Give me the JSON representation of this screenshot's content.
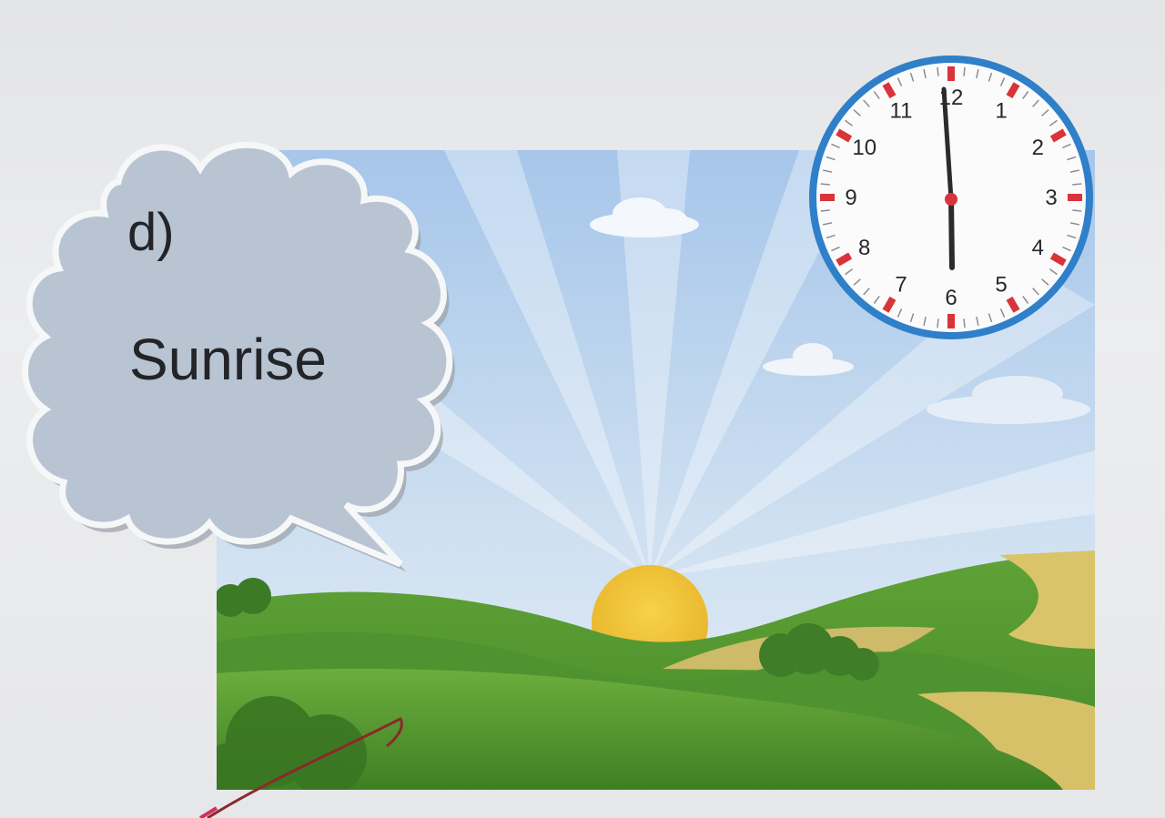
{
  "question": {
    "letter": "d)",
    "label": "Sunrise"
  },
  "clock": {
    "numbers": [
      "12",
      "1",
      "2",
      "3",
      "4",
      "5",
      "6",
      "7",
      "8",
      "9",
      "10",
      "11"
    ],
    "time_shown": "6:00",
    "rim_color": "#2f7fc9",
    "marker_color": "#d8343a"
  },
  "colors": {
    "sky_top": "#a9c8ea",
    "sky_bottom": "#dfe9f3",
    "grass": "#5d9e34",
    "sun": "#f1c233",
    "bubble": "#b7c3d2"
  }
}
